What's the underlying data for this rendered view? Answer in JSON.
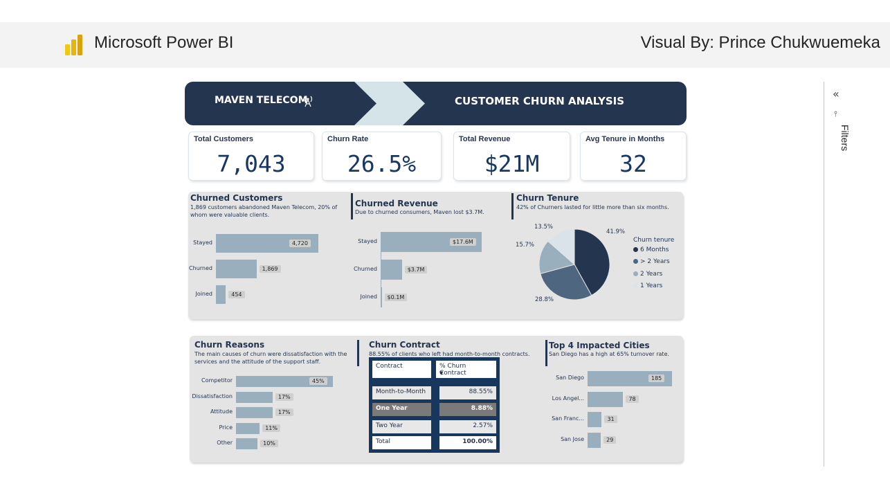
{
  "app": {
    "title": "Microsoft Power BI",
    "credit": "Visual By: Prince Chukwuemeka"
  },
  "filters": {
    "label": "Filters",
    "collapse_icon": "double-chevron-left-icon",
    "filter_icon": "filter-icon"
  },
  "banner": {
    "company": "MAVEN TELECOM",
    "title": "CUSTOMER CHURN ANALYSIS",
    "icon": "antenna-icon"
  },
  "kpis": [
    {
      "label": "Total Customers",
      "value": "7,043"
    },
    {
      "label": "Churn Rate",
      "value": "26.5%"
    },
    {
      "label": "Total Revenue",
      "value": "$21M"
    },
    {
      "label": "Avg Tenure in Months",
      "value": "32"
    }
  ],
  "churned_customers": {
    "title": "Churned Customers",
    "subtitle": "1,869 customers abandoned Maven Telecom, 20% of whom were valuable clients.",
    "categories": [
      "Stayed",
      "Churned",
      "Joined"
    ],
    "values": [
      4720,
      1869,
      454
    ],
    "labels": [
      "4,720",
      "1,869",
      "454"
    ]
  },
  "churned_revenue": {
    "title": "Churned Revenue",
    "subtitle": "Due to churned consumers, Maven lost $3.7M.",
    "categories": [
      "Stayed",
      "Churned",
      "Joined"
    ],
    "values": [
      17.6,
      3.7,
      0.1
    ],
    "labels": [
      "$17.6M",
      "$3.7M",
      "$0.1M"
    ]
  },
  "churn_tenure": {
    "title": "Churn Tenure",
    "subtitle": "42% of Churners lasted for little more than six months.",
    "legend_title": "Churn tenure",
    "slices": [
      {
        "name": "6 Months",
        "value": 41.9,
        "label": "41.9%",
        "color": "#243550"
      },
      {
        "name": "> 2 Years",
        "value": 28.8,
        "label": "28.8%",
        "color": "#4f6680"
      },
      {
        "name": "2 Years",
        "value": 15.7,
        "label": "15.7%",
        "color": "#9aafbe"
      },
      {
        "name": "1 Years",
        "value": 13.5,
        "label": "13.5%",
        "color": "#dbe3ea"
      }
    ]
  },
  "churn_reasons": {
    "title": "Churn Reasons",
    "subtitle": "The main causes of churn were dissatisfaction with the services and the attitude of the support staff.",
    "categories": [
      "Competitor",
      "Dissatisfaction",
      "Attitude",
      "Price",
      "Other"
    ],
    "values": [
      45,
      17,
      17,
      11,
      10
    ],
    "labels": [
      "45%",
      "17%",
      "17%",
      "11%",
      "10%"
    ]
  },
  "churn_contract": {
    "title": "Churn Contract",
    "subtitle": "88.55% of clients who left had month-to-month contracts.",
    "headers": [
      "Contract",
      "% Churn Contract"
    ],
    "rows": [
      [
        "Month-to-Month",
        "88.55%"
      ],
      [
        "One Year",
        "8.88%"
      ],
      [
        "Two Year",
        "2.57%"
      ],
      [
        "Total",
        "100.00%"
      ]
    ]
  },
  "top_cities": {
    "title": "Top 4 Impacted Cities",
    "subtitle": "San Diego has a high at 65% turnover rate.",
    "categories": [
      "San Diego",
      "Los Angel...",
      "San Franc...",
      "San Jose"
    ],
    "values": [
      185,
      78,
      31,
      29
    ],
    "labels": [
      "185",
      "78",
      "31",
      "29"
    ]
  },
  "colors": {
    "navy": "#243550",
    "bar": "#9aafbe",
    "panel": "#e4e4e4",
    "table_bg": "#17375e"
  },
  "chart_data": [
    {
      "type": "bar",
      "title": "Churned Customers",
      "categories": [
        "Stayed",
        "Churned",
        "Joined"
      ],
      "values": [
        4720,
        1869,
        454
      ]
    },
    {
      "type": "bar",
      "title": "Churned Revenue",
      "categories": [
        "Stayed",
        "Churned",
        "Joined"
      ],
      "values": [
        17.6,
        3.7,
        0.1
      ],
      "unit": "$M"
    },
    {
      "type": "pie",
      "title": "Churn Tenure",
      "categories": [
        "6 Months",
        "> 2 Years",
        "2 Years",
        "1 Years"
      ],
      "values": [
        41.9,
        28.8,
        15.7,
        13.5
      ],
      "legend": "right"
    },
    {
      "type": "bar",
      "title": "Churn Reasons",
      "categories": [
        "Competitor",
        "Dissatisfaction",
        "Attitude",
        "Price",
        "Other"
      ],
      "values": [
        45,
        17,
        17,
        11,
        10
      ],
      "unit": "%"
    },
    {
      "type": "table",
      "title": "Churn Contract",
      "categories": [
        "Month-to-Month",
        "One Year",
        "Two Year",
        "Total"
      ],
      "values": [
        88.55,
        8.88,
        2.57,
        100.0
      ]
    },
    {
      "type": "bar",
      "title": "Top 4 Impacted Cities",
      "categories": [
        "San Diego",
        "Los Angel...",
        "San Franc...",
        "San Jose"
      ],
      "values": [
        185,
        78,
        31,
        29
      ]
    }
  ]
}
